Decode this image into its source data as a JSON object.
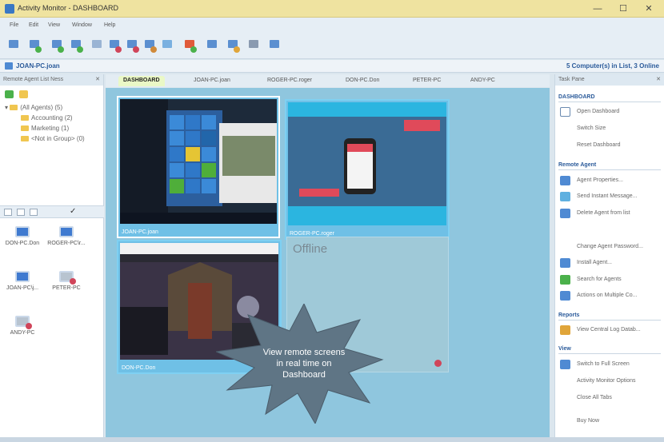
{
  "window": {
    "title": "Activity Monitor - DASHBOARD"
  },
  "menu": [
    "File",
    "Edit",
    "View",
    "Window",
    "Help"
  ],
  "status": {
    "pc": "JOAN-PC.joan",
    "count": "5 Computer(s) in List, 3 Online"
  },
  "left_pane": {
    "title": "Remote Agent List Ness",
    "tree": {
      "root": "(All Agents) (5)",
      "groups": [
        "Accounting (2)",
        "Marketing (1)",
        "<Not in Group> (0)"
      ]
    },
    "agents": [
      "DON-PC.Don",
      "ROGER-PC\\r...",
      "JOAN-PC\\j...",
      "PETER-PC",
      "ANDY-PC"
    ]
  },
  "tabs": [
    "DASHBOARD",
    "JOAN-PC.joan",
    "ROGER-PC.roger",
    "DON-PC.Don",
    "PETER-PC",
    "ANDY-PC"
  ],
  "dashboard": {
    "thumbs": [
      "JOAN-PC.joan",
      "ROGER-PC.roger",
      "DON-PC.Don"
    ],
    "offline_label": "Offline",
    "callout": [
      "View remote screens",
      "in real time on",
      "Dashboard"
    ]
  },
  "task_pane": {
    "title": "Task Pane",
    "sections": [
      {
        "name": "DASHBOARD",
        "items": [
          "Open Dashboard",
          "Switch Size",
          "Reset Dashboard"
        ]
      },
      {
        "name": "Remote Agent",
        "items": [
          "Agent Properties...",
          "Send Instant Message...",
          "Delete Agent from list",
          "Change Agent Password...",
          "Install Agent...",
          "Search for Agents",
          "Actions on Multiple Co..."
        ]
      },
      {
        "name": "Reports",
        "items": [
          "View Central Log Datab..."
        ]
      },
      {
        "name": "View",
        "items": [
          "Switch to Full Screen",
          "Activity Monitor Options",
          "Close All Tabs",
          "Buy Now"
        ]
      }
    ]
  }
}
